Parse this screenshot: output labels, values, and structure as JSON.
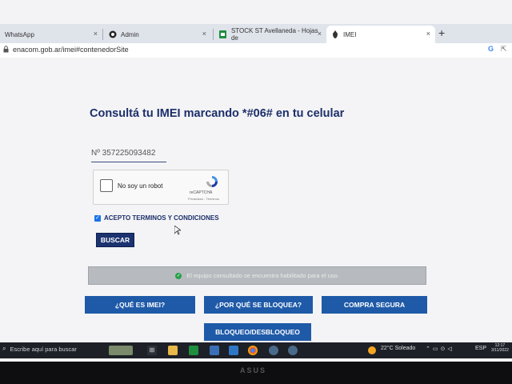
{
  "browser": {
    "tabs": [
      {
        "label": "WhatsApp",
        "icon": "whatsapp-icon"
      },
      {
        "label": "Admin",
        "icon": "github-icon"
      },
      {
        "label": "STOCK ST Avellaneda - Hojas de",
        "icon": "sheets-icon"
      },
      {
        "label": "IMEI",
        "icon": "enacom-icon"
      }
    ],
    "new_tab": "+",
    "close": "×",
    "url": "enacom.gob.ar/imei#contenedorSite"
  },
  "page": {
    "title": "Consultá tu IMEI marcando *#06# en tu celular",
    "imei_value": "Nº 357225093482",
    "captcha": {
      "label": "No soy un robot",
      "brand": "reCAPTCHA",
      "terms": "Privacidad - Términos"
    },
    "accept_label": "ACEPTO TERMINOS Y CONDICIONES",
    "search_button": "BUSCAR",
    "status_message": "El equipo consultado se encuentra habilitado para el uso.",
    "buttons": {
      "que_es": "¿QUÉ ES IMEI?",
      "por_que": "¿POR QUÉ SE BLOQUEA?",
      "compra": "COMPRA SEGURA",
      "bloqueo": "BLOQUEO/DESBLOQUEO"
    }
  },
  "taskbar": {
    "search_placeholder": "Escribe aquí para buscar",
    "weather": "22°C  Soleado",
    "language": "ESP",
    "time": "12:17",
    "date": "3/11/2022"
  },
  "monitor_brand": "ASUS"
}
